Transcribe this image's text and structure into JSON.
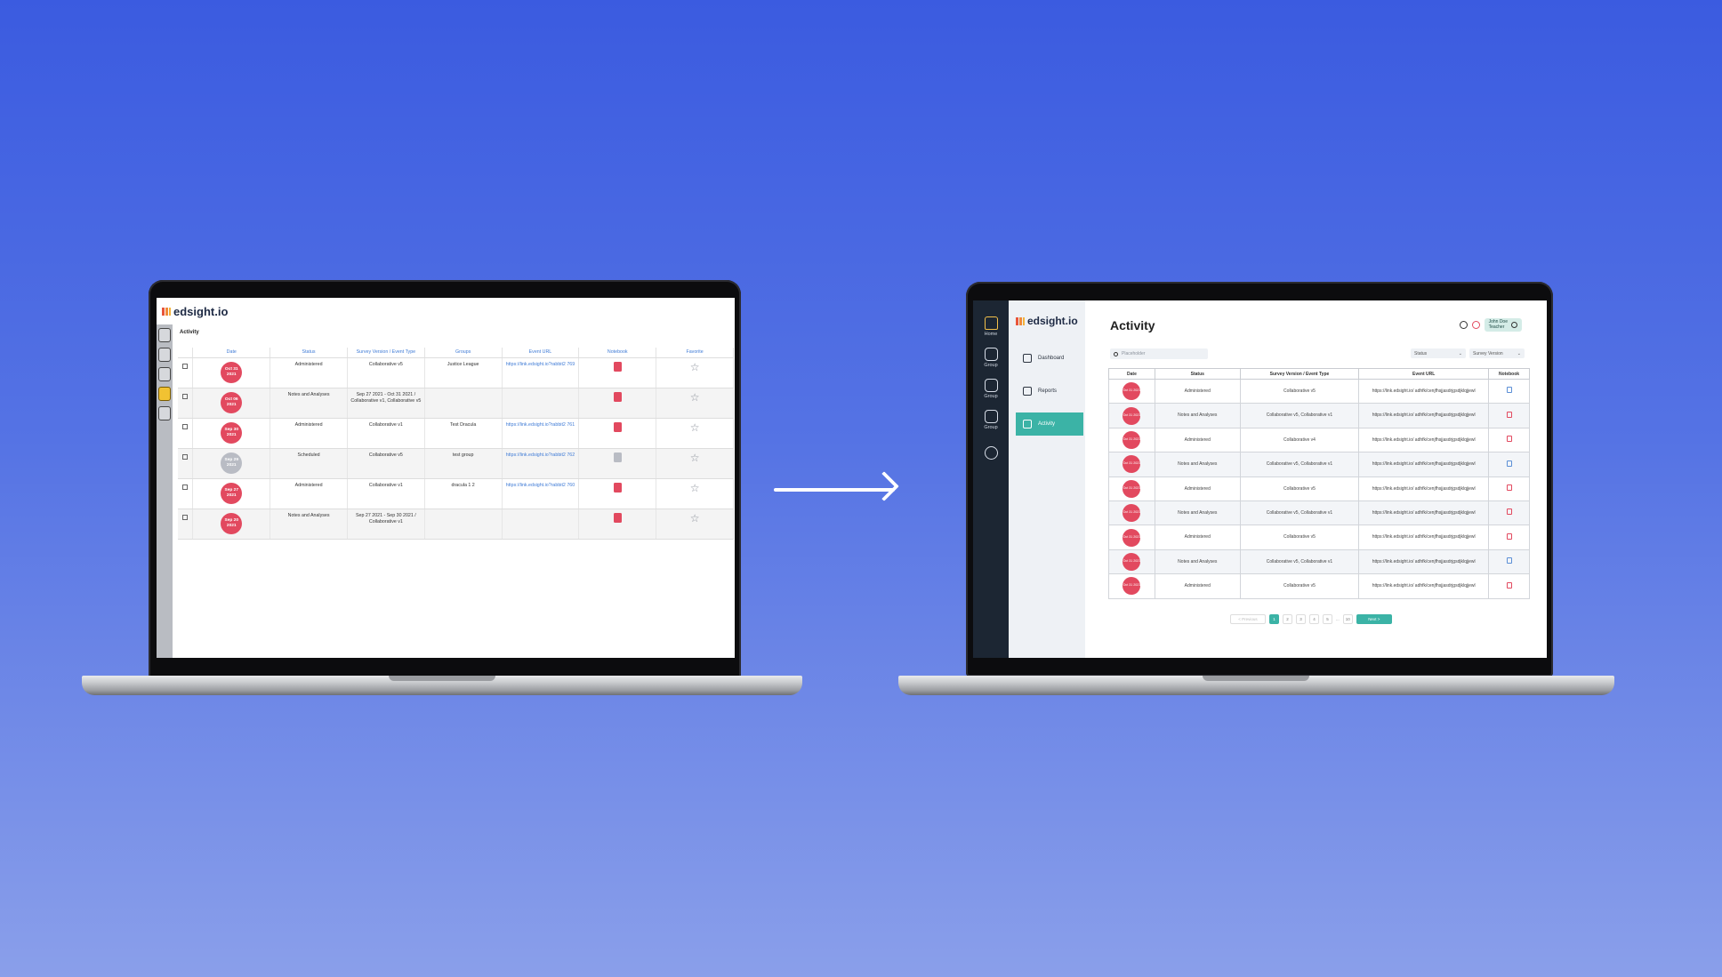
{
  "old_ui": {
    "brand": "edsight.io",
    "page_title": "Activity",
    "columns": [
      "",
      "Date",
      "Status",
      "Survey Version / Event Type",
      "Groups",
      "Event URL",
      "Notebook",
      "Favorite"
    ],
    "rows": [
      {
        "date_top": "Oct 31",
        "date_bottom": "2021",
        "status": "Administered",
        "survey": "Collaborative v5",
        "groups": "Justice League",
        "url": "https://link.edsight.io?rabbit2 769",
        "notebook": "red",
        "date_color": "red"
      },
      {
        "date_top": "Oct 06",
        "date_bottom": "2021",
        "status": "Notes and Analyses",
        "survey": "Sep 27 2021 - Oct 31 2021 / Collaborative v1, Collaborative v5",
        "groups": "",
        "url": "",
        "notebook": "red",
        "date_color": "red"
      },
      {
        "date_top": "Sep 30",
        "date_bottom": "2021",
        "status": "Administered",
        "survey": "Collaborative v1",
        "groups": "Test Dracula",
        "url": "https://link.edsight.io?rabbit2 761",
        "notebook": "red",
        "date_color": "red"
      },
      {
        "date_top": "Sep 29",
        "date_bottom": "2021",
        "status": "Scheduled",
        "survey": "Collaborative v5",
        "groups": "test group",
        "url": "https://link.edsight.io?rabbit2 762",
        "notebook": "grey",
        "date_color": "grey"
      },
      {
        "date_top": "Sep 27",
        "date_bottom": "2021",
        "status": "Administered",
        "survey": "Collaborative v1",
        "groups": "dracula 1 2",
        "url": "https://link.edsight.io?rabbit2 760",
        "notebook": "red",
        "date_color": "red"
      },
      {
        "date_top": "Sep 20",
        "date_bottom": "2021",
        "status": "Notes and Analyses",
        "survey": "Sep 27 2021 - Sep 30 2021 / Collaborative v1",
        "groups": "",
        "url": "",
        "notebook": "red",
        "date_color": "red"
      }
    ]
  },
  "new_ui": {
    "rail": [
      {
        "label": "Home",
        "icon": "home-icon"
      },
      {
        "label": "Group",
        "icon": "users-icon"
      },
      {
        "label": "Group",
        "icon": "users-icon"
      },
      {
        "label": "Group",
        "icon": "users-icon"
      },
      {
        "label": "",
        "icon": "plus-circle-icon"
      }
    ],
    "brand": "edsight.io",
    "nav": [
      {
        "label": "Dashboard",
        "icon": "chart-line-icon"
      },
      {
        "label": "Reports",
        "icon": "document-icon"
      },
      {
        "label": "Activity",
        "icon": "file-icon"
      }
    ],
    "page_title": "Activity",
    "user": {
      "name": "John Doe",
      "role": "Teacher"
    },
    "search_placeholder": "Placeholder",
    "filters": {
      "status": "Status",
      "survey_version": "Survey Version"
    },
    "columns": [
      "Date",
      "Status",
      "Survey Version / Event Type",
      "Event URL",
      "Notebook"
    ],
    "rows": [
      {
        "date": "Oct 31 2021",
        "status": "Administered",
        "survey": "Collaborative v5",
        "url": "https://link.edsight.io/ adhfk/cenjfhsjjasdrjgsdjklqjjewl",
        "notebook": "blue"
      },
      {
        "date": "Oct 31 2021",
        "status": "Notes and Analyses",
        "survey": "Collaborative v5, Collaborative v1",
        "url": "https://link.edsight.io/ adhfk/cenjfhsjjasdrjgsdjklqjjewl",
        "notebook": "red"
      },
      {
        "date": "Oct 31 2021",
        "status": "Administered",
        "survey": "Collaborative v4",
        "url": "https://link.edsight.io/ adhfk/cenjfhsjjasdrjgsdjklqjjewl",
        "notebook": "red"
      },
      {
        "date": "Oct 31 2021",
        "status": "Notes and Analyses",
        "survey": "Collaborative v5, Collaborative v1",
        "url": "https://link.edsight.io/ adhfk/cenjfhsjjasdrjgsdjklqjjewl",
        "notebook": "blue"
      },
      {
        "date": "Oct 31 2021",
        "status": "Administered",
        "survey": "Collaborative v5",
        "url": "https://link.edsight.io/ adhfk/cenjfhsjjasdrjgsdjklqjjewl",
        "notebook": "red"
      },
      {
        "date": "Oct 31 2021",
        "status": "Notes and Analyses",
        "survey": "Collaborative v5, Collaborative v1",
        "url": "https://link.edsight.io/ adhfk/cenjfhsjjasdrjgsdjklqjjewl",
        "notebook": "red"
      },
      {
        "date": "Oct 31 2021",
        "status": "Administered",
        "survey": "Collaborative v5",
        "url": "https://link.edsight.io/ adhfk/cenjfhsjjasdrjgsdjklqjjewl",
        "notebook": "red"
      },
      {
        "date": "Oct 31 2021",
        "status": "Notes and Analyses",
        "survey": "Collaborative v5, Collaborative v1",
        "url": "https://link.edsight.io/ adhfk/cenjfhsjjasdrjgsdjklqjjewl",
        "notebook": "blue"
      },
      {
        "date": "Oct 31 2021",
        "status": "Administered",
        "survey": "Collaborative v5",
        "url": "https://link.edsight.io/ adhfk/cenjfhsjjasdrjgsdjklqjjewl",
        "notebook": "red"
      }
    ],
    "pagination": {
      "prev": "< Previous",
      "pages": [
        "1",
        "2",
        "3",
        "4",
        "5",
        "...",
        "10"
      ],
      "active": "1",
      "next": "Next >"
    }
  },
  "colors": {
    "accent": "#3bb3a6",
    "date_red": "#e2495f",
    "background_top": "#3b5be0",
    "background_bottom": "#8a9fea"
  }
}
